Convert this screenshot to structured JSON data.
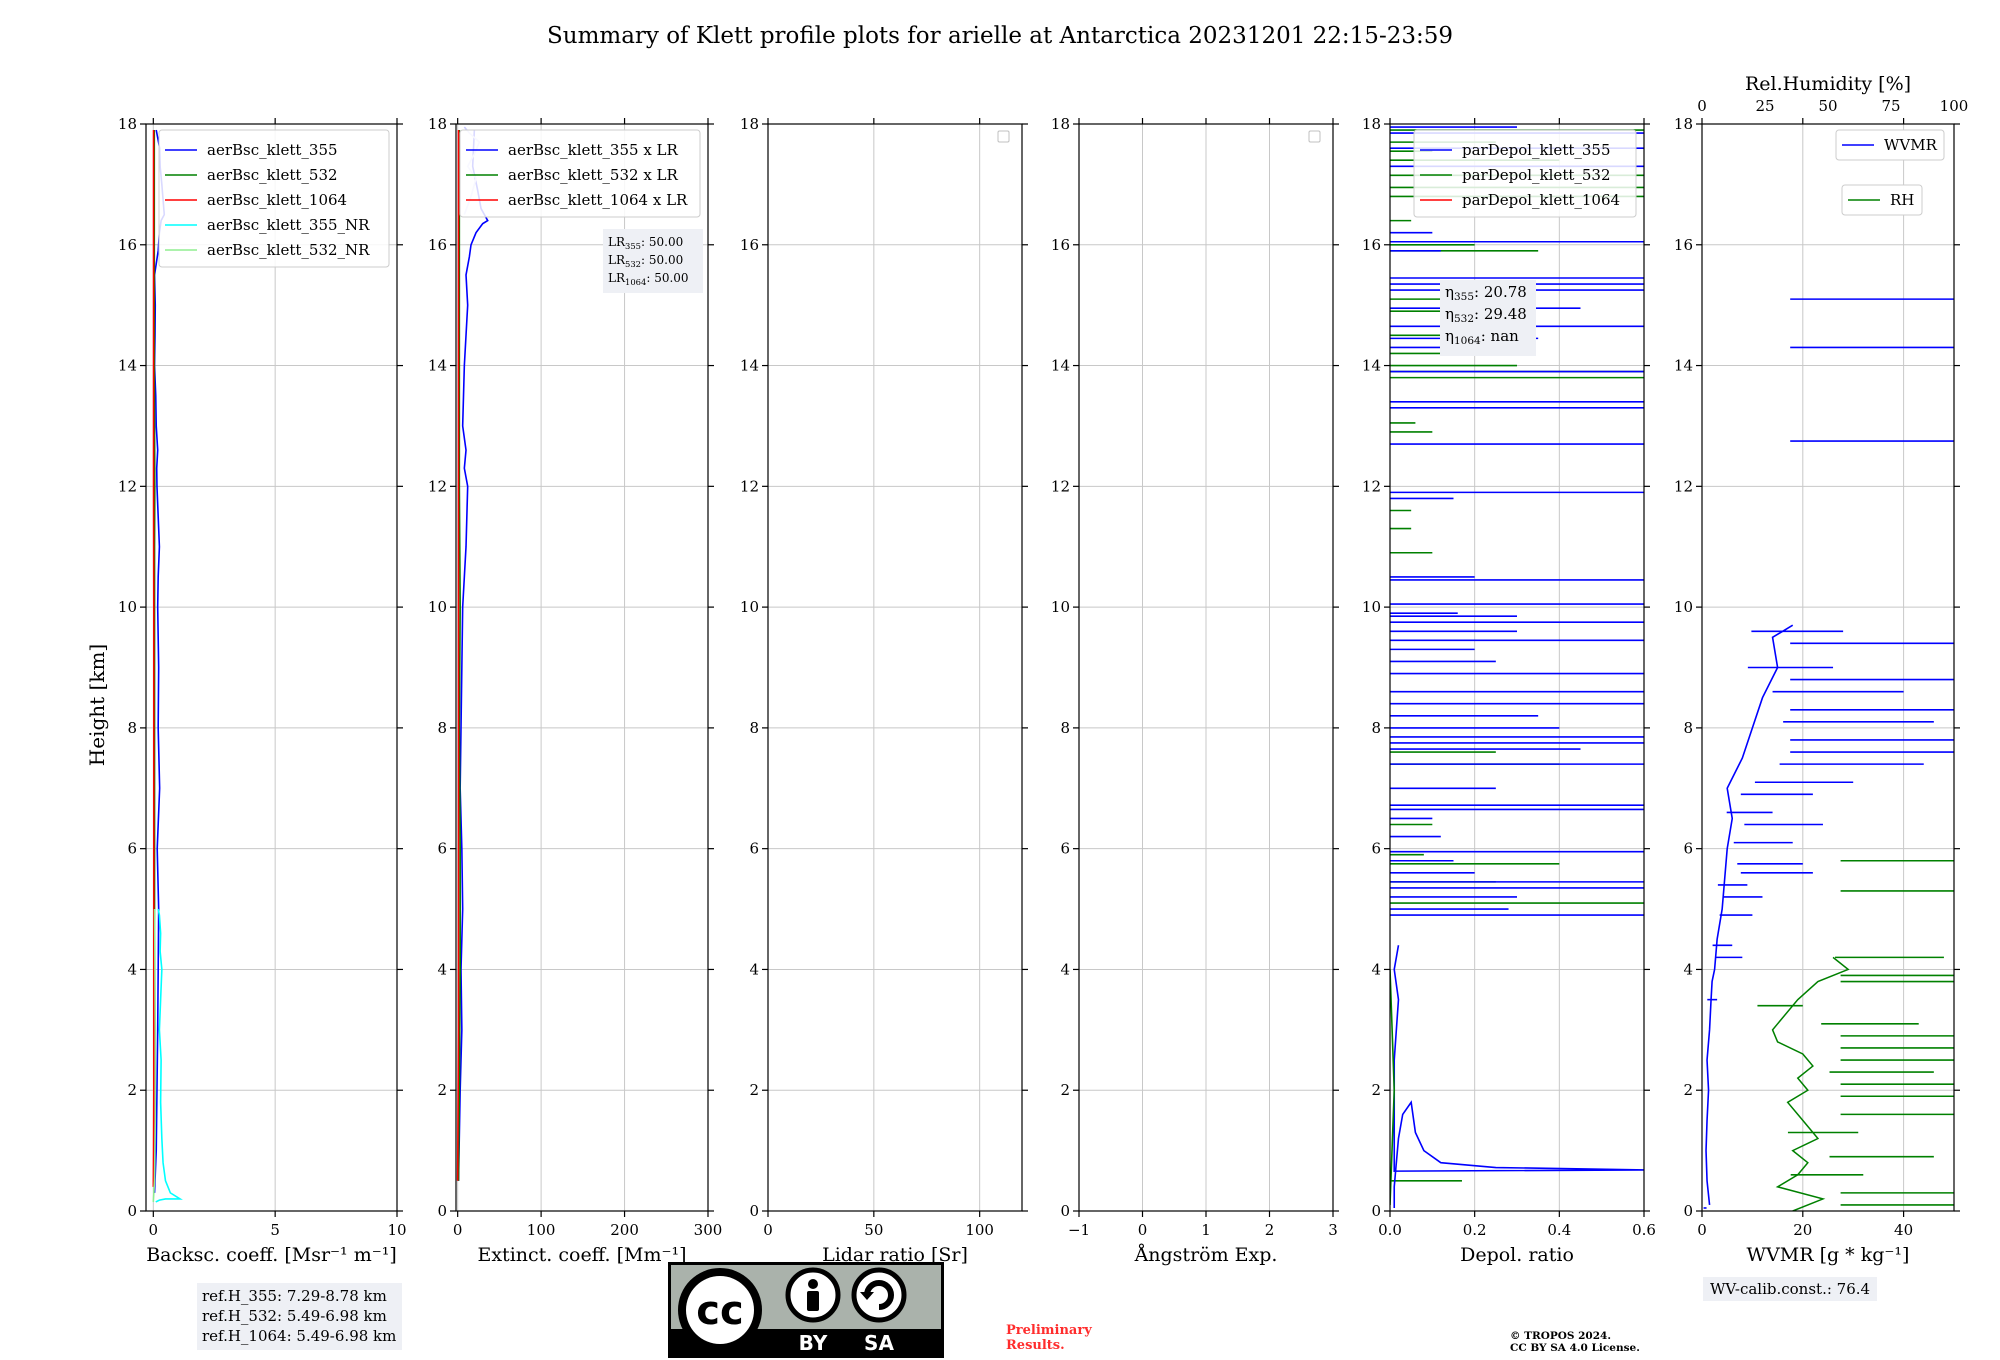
{
  "title": "Summary of Klett profile plots for arielle at Antarctica 20231201 22:15-23:59",
  "y_label": "Height [km]",
  "chart_data": [
    {
      "type": "line",
      "xlabel": "Backsc. coeff. [Msr⁻¹ m⁻¹]",
      "xlim": [
        -0.3,
        10
      ],
      "ylim": [
        0,
        18
      ],
      "xticks": [
        "0",
        "5",
        "10"
      ],
      "xtick_values": [
        0,
        5,
        10
      ],
      "legend_position": "top-right",
      "grid": true,
      "series": [
        {
          "name": "aerBsc_klett_355",
          "color": "#0000ff",
          "x": [
            0.05,
            0.12,
            0.15,
            0.18,
            0.2,
            0.22,
            0.16,
            0.26,
            0.2,
            0.22,
            0.18,
            0.2,
            0.25,
            0.2,
            0.15,
            0.14,
            0.18,
            0.12,
            0.1,
            0.05,
            0.07,
            0.08,
            0.05,
            0.2,
            0.25,
            0.32,
            0.45,
            0.35,
            0.28,
            0.26,
            0.12
          ],
          "y": [
            0.3,
            1.0,
            2.0,
            3.0,
            4.0,
            5.0,
            6.0,
            7.0,
            8.0,
            9.0,
            10.0,
            10.5,
            11.0,
            11.5,
            12.0,
            12.3,
            12.6,
            13.0,
            13.5,
            14.0,
            14.5,
            15.0,
            15.5,
            15.9,
            16.2,
            16.4,
            16.5,
            17.0,
            17.3,
            17.6,
            17.9
          ]
        },
        {
          "name": "aerBsc_klett_532",
          "color": "#008000",
          "x": [
            0.02,
            0.04,
            0.06,
            0.05,
            0.04,
            0.05,
            0.05,
            0.05,
            0.05,
            0.05,
            0.05,
            0.05,
            0.06,
            0.05,
            0.04,
            0.04,
            0.04,
            0.04,
            0.04
          ],
          "y": [
            0.5,
            1.0,
            2.0,
            3.0,
            4.0,
            5.0,
            6.0,
            7.0,
            8.0,
            9.0,
            10.0,
            11.0,
            12.0,
            13.0,
            14.0,
            15.0,
            16.0,
            17.0,
            17.9
          ]
        },
        {
          "name": "aerBsc_klett_1064",
          "color": "#ff0000",
          "x": [
            0.0,
            0.01,
            0.02,
            0.02,
            0.02,
            0.02,
            0.02,
            0.01,
            0.01,
            0.01,
            0.01
          ],
          "y": [
            0.4,
            1.0,
            2.0,
            4.0,
            6.0,
            8.0,
            10.0,
            12.0,
            14.0,
            16.0,
            17.9
          ]
        },
        {
          "name": "aerBsc_klett_355_NR",
          "color": "#00ffff",
          "x": [
            0.1,
            0.25,
            0.5,
            1.1,
            0.7,
            0.5,
            0.4,
            0.35,
            0.3,
            0.32,
            0.25,
            0.3,
            0.35,
            0.28,
            0.3,
            0.25,
            0.2
          ],
          "y": [
            0.15,
            0.18,
            0.2,
            0.2,
            0.3,
            0.5,
            0.8,
            1.2,
            1.8,
            2.5,
            3.0,
            3.5,
            4.0,
            4.3,
            4.6,
            4.9,
            5.0
          ]
        },
        {
          "name": "aerBsc_klett_532_NR",
          "color": "#90ee90",
          "x": [
            0.0,
            0.05,
            0.08,
            0.08,
            0.06,
            0.05
          ],
          "y": [
            0.15,
            0.5,
            1.5,
            3.0,
            4.5,
            5.0
          ]
        }
      ]
    },
    {
      "type": "line",
      "xlabel": "Extinct. coeff. [Mm⁻¹]",
      "xlim": [
        -2,
        300
      ],
      "ylim": [
        0,
        18
      ],
      "xticks": [
        "0",
        "100",
        "200",
        "300"
      ],
      "xtick_values": [
        0,
        100,
        200,
        300
      ],
      "legend_position": "top-right",
      "grid": true,
      "series": [
        {
          "name": "aerBsc_klett_355 x LR",
          "color": "#0000ff",
          "x": [
            1,
            3,
            5,
            4,
            6,
            5,
            3,
            4,
            5,
            6,
            8,
            10,
            12,
            8,
            10,
            6,
            8,
            10,
            12,
            10,
            14,
            16,
            22,
            30,
            36,
            28,
            24,
            18,
            20
          ],
          "y": [
            0.5,
            2.0,
            3.0,
            4.0,
            5.0,
            6.0,
            7.0,
            8.0,
            9.0,
            10.0,
            10.5,
            11.0,
            12.0,
            12.3,
            12.6,
            13.0,
            14.0,
            14.5,
            15.0,
            15.5,
            15.8,
            16.0,
            16.2,
            16.35,
            16.4,
            16.6,
            16.9,
            17.3,
            17.9
          ]
        },
        {
          "name": "aerBsc_klett_532 x LR",
          "color": "#008000",
          "x": [
            1,
            2,
            3,
            3,
            2,
            3,
            2,
            2,
            2,
            2
          ],
          "y": [
            0.5,
            2.0,
            4.0,
            6.0,
            8.0,
            10.0,
            12.0,
            14.0,
            16.0,
            17.9
          ]
        },
        {
          "name": "aerBsc_klett_1064 x LR",
          "color": "#ff0000",
          "x": [
            0,
            1,
            1,
            1,
            1,
            1
          ],
          "y": [
            0.5,
            3.0,
            6.0,
            10.0,
            14.0,
            17.9
          ]
        },
        {
          "name": "",
          "color": "#ccccff",
          "x": [
            8,
            16,
            22,
            12,
            20,
            26,
            14,
            8
          ],
          "y": [
            16.5,
            16.8,
            17.1,
            17.3,
            17.5,
            17.7,
            17.85,
            17.95
          ]
        }
      ],
      "annotation": [
        {
          "label": "LR",
          "sub": "355",
          "value": ": 50.00"
        },
        {
          "label": "LR",
          "sub": "532",
          "value": ": 50.00"
        },
        {
          "label": "LR",
          "sub": "1064",
          "value": ": 50.00"
        }
      ]
    },
    {
      "type": "line",
      "xlabel": "Lidar ratio [Sr]",
      "xlim": [
        0,
        120
      ],
      "ylim": [
        0,
        18
      ],
      "xticks": [
        "0",
        "50",
        "100"
      ],
      "xtick_values": [
        0,
        50,
        100
      ],
      "legend_position": "top-right",
      "grid": true,
      "series": []
    },
    {
      "type": "line",
      "xlabel": "Ångström Exp.",
      "xlim": [
        -1,
        3
      ],
      "ylim": [
        0,
        18
      ],
      "xticks": [
        "−1",
        "0",
        "1",
        "2",
        "3"
      ],
      "xtick_values": [
        -1,
        0,
        1,
        2,
        3
      ],
      "legend_position": "top-right",
      "grid": true,
      "series": []
    },
    {
      "type": "line",
      "xlabel": "Depol. ratio",
      "xlim": [
        0,
        0.6
      ],
      "ylim": [
        0,
        18
      ],
      "xticks": [
        "0.0",
        "0.2",
        "0.4",
        "0.6"
      ],
      "xtick_values": [
        0.0,
        0.2,
        0.4,
        0.6
      ],
      "legend_position": "top-right",
      "grid": true,
      "series": [
        {
          "name": "parDepol_klett_355",
          "color": "#0000ff",
          "x": [
            0.01,
            0.01,
            0.02,
            0.03,
            0.05,
            0.06,
            0.08,
            0.12,
            0.25,
            0.6,
            0.01,
            0.01,
            0.02,
            0.01,
            0.02
          ],
          "y": [
            0.05,
            0.4,
            1.2,
            1.6,
            1.8,
            1.3,
            1.0,
            0.8,
            0.72,
            0.68,
            0.66,
            2.5,
            3.5,
            4.0,
            4.4
          ]
        },
        {
          "name": "parDepol_klett_532",
          "color": "#008000",
          "x": [
            0.0,
            0.01,
            0.0
          ],
          "y": [
            0.1,
            2.0,
            4.0
          ]
        },
        {
          "name": "parDepol_klett_1064",
          "color": "#ff0000",
          "x": [],
          "y": []
        }
      ],
      "spikes_355": [
        [
          4.9,
          0.6
        ],
        [
          5.0,
          0.28
        ],
        [
          5.2,
          0.3
        ],
        [
          5.35,
          0.6
        ],
        [
          5.45,
          0.6
        ],
        [
          5.6,
          0.2
        ],
        [
          5.8,
          0.15
        ],
        [
          5.95,
          0.6
        ],
        [
          6.2,
          0.12
        ],
        [
          6.5,
          0.1
        ],
        [
          6.65,
          0.6
        ],
        [
          6.72,
          0.6
        ],
        [
          7.0,
          0.25
        ],
        [
          7.4,
          0.6
        ],
        [
          7.65,
          0.45
        ],
        [
          7.75,
          0.6
        ],
        [
          7.85,
          0.6
        ],
        [
          8.0,
          0.4
        ],
        [
          8.2,
          0.35
        ],
        [
          8.4,
          0.6
        ],
        [
          8.6,
          0.6
        ],
        [
          8.9,
          0.6
        ],
        [
          9.1,
          0.25
        ],
        [
          9.3,
          0.2
        ],
        [
          9.45,
          0.6
        ],
        [
          9.6,
          0.3
        ],
        [
          9.75,
          0.6
        ],
        [
          9.85,
          0.3
        ],
        [
          9.9,
          0.16
        ],
        [
          10.05,
          0.6
        ],
        [
          10.45,
          0.6
        ],
        [
          10.5,
          0.2
        ],
        [
          11.8,
          0.15
        ],
        [
          11.9,
          0.6
        ],
        [
          12.7,
          0.6
        ],
        [
          13.3,
          0.6
        ],
        [
          13.4,
          0.6
        ],
        [
          13.9,
          0.6
        ],
        [
          14.3,
          0.2
        ],
        [
          14.45,
          0.35
        ],
        [
          14.65,
          0.6
        ],
        [
          14.95,
          0.45
        ],
        [
          15.25,
          0.6
        ],
        [
          15.35,
          0.6
        ],
        [
          15.45,
          0.6
        ],
        [
          15.9,
          0.12
        ],
        [
          16.05,
          0.6
        ],
        [
          16.2,
          0.1
        ],
        [
          17.3,
          0.6
        ],
        [
          17.6,
          0.6
        ],
        [
          17.85,
          0.6
        ],
        [
          17.95,
          0.3
        ]
      ],
      "spikes_532": [
        [
          0.5,
          0.17
        ],
        [
          5.1,
          0.6
        ],
        [
          5.45,
          0.25
        ],
        [
          5.75,
          0.4
        ],
        [
          5.9,
          0.08
        ],
        [
          6.4,
          0.1
        ],
        [
          7.4,
          0.4
        ],
        [
          7.6,
          0.25
        ],
        [
          10.9,
          0.1
        ],
        [
          11.3,
          0.05
        ],
        [
          11.6,
          0.05
        ],
        [
          12.9,
          0.1
        ],
        [
          13.05,
          0.06
        ],
        [
          13.8,
          0.6
        ],
        [
          13.9,
          0.6
        ],
        [
          14.0,
          0.3
        ],
        [
          14.2,
          0.2
        ],
        [
          14.5,
          0.12
        ],
        [
          14.9,
          0.3
        ],
        [
          15.1,
          0.25
        ],
        [
          15.9,
          0.35
        ],
        [
          16.0,
          0.2
        ],
        [
          16.4,
          0.05
        ],
        [
          16.8,
          0.6
        ],
        [
          16.95,
          0.6
        ],
        [
          17.15,
          0.6
        ],
        [
          17.4,
          0.4
        ],
        [
          17.55,
          0.1
        ],
        [
          17.7,
          0.25
        ],
        [
          17.9,
          0.6
        ]
      ],
      "annotation": [
        {
          "label": "η",
          "sub": "355",
          "value": ": 20.78"
        },
        {
          "label": "η",
          "sub": "532",
          "value": ": 29.48"
        },
        {
          "label": "η",
          "sub": "1064",
          "value": ": nan"
        }
      ]
    },
    {
      "type": "line",
      "xlabel": "WVMR [g * kg⁻¹]",
      "x2label": "Rel.Humidity [%]",
      "xlim": [
        0,
        50
      ],
      "ylim": [
        0,
        18
      ],
      "xticks": [
        "0",
        "20",
        "40"
      ],
      "xtick_values": [
        0,
        20,
        40
      ],
      "x2lim": [
        0,
        100
      ],
      "x2ticks": [
        "0",
        "25",
        "50",
        "75",
        "100"
      ],
      "x2tick_values": [
        0,
        25,
        50,
        75,
        100
      ],
      "legend_position": "top-right",
      "grid": true,
      "series": [
        {
          "name": "WVMR",
          "color": "#0000ff",
          "x": [
            1.5,
            1.0,
            0.8,
            1.0,
            1.3,
            1.0,
            1.5,
            1.8,
            2.0,
            2.5,
            3.0,
            4.0,
            4.5,
            5.0,
            6.0,
            5.0,
            8.0,
            10.0,
            12.0,
            15.0,
            14.0,
            16.0,
            18.0
          ],
          "y": [
            0.1,
            0.5,
            1.0,
            1.5,
            2.0,
            2.5,
            3.0,
            3.5,
            3.8,
            4.0,
            4.5,
            5.0,
            5.5,
            6.0,
            6.5,
            7.0,
            7.5,
            8.0,
            8.5,
            9.0,
            9.5,
            9.6,
            9.7
          ]
        },
        {
          "name": "RH",
          "color": "#008000",
          "x": [],
          "y": []
        }
      ],
      "spikes_wvmr": [
        [
          0.05,
          0.9
        ],
        [
          3.5,
          3
        ],
        [
          4.2,
          8
        ],
        [
          4.4,
          6
        ],
        [
          4.9,
          10
        ],
        [
          5.2,
          12
        ],
        [
          5.4,
          9
        ],
        [
          5.6,
          22
        ],
        [
          5.75,
          20
        ],
        [
          6.1,
          18
        ],
        [
          6.4,
          24
        ],
        [
          6.6,
          14
        ],
        [
          6.9,
          22
        ],
        [
          7.1,
          30
        ],
        [
          7.4,
          44
        ],
        [
          7.6,
          50
        ],
        [
          7.8,
          50
        ],
        [
          8.1,
          46
        ],
        [
          8.3,
          50
        ],
        [
          8.6,
          40
        ],
        [
          8.8,
          50
        ],
        [
          9.0,
          26
        ],
        [
          9.4,
          50
        ],
        [
          9.6,
          28
        ],
        [
          12.75,
          50
        ],
        [
          14.3,
          50
        ],
        [
          15.1,
          50
        ]
      ],
      "spikes_rh_pct": [
        [
          0.1,
          100
        ],
        [
          0.3,
          100
        ],
        [
          0.6,
          64
        ],
        [
          0.9,
          92
        ],
        [
          1.3,
          62
        ],
        [
          1.6,
          100
        ],
        [
          1.9,
          100
        ],
        [
          2.1,
          100
        ],
        [
          2.3,
          92
        ],
        [
          2.5,
          100
        ],
        [
          2.7,
          100
        ],
        [
          2.9,
          100
        ],
        [
          3.1,
          86
        ],
        [
          3.4,
          40
        ],
        [
          3.8,
          100
        ],
        [
          3.9,
          100
        ],
        [
          4.2,
          96
        ],
        [
          5.3,
          100
        ],
        [
          5.8,
          100
        ]
      ],
      "rh_profile": {
        "x_pct": [
          36,
          48,
          30,
          38,
          42,
          36,
          46,
          40,
          34,
          42,
          38,
          44,
          40,
          30,
          28,
          32,
          38,
          46,
          58,
          52
        ],
        "y": [
          0.0,
          0.2,
          0.4,
          0.6,
          0.8,
          1.0,
          1.2,
          1.5,
          1.8,
          2.0,
          2.2,
          2.4,
          2.6,
          2.8,
          3.0,
          3.2,
          3.5,
          3.8,
          4.0,
          4.2
        ]
      }
    }
  ],
  "ref_heights": [
    "ref.H_355: 7.29-8.78 km",
    "ref.H_532: 5.49-6.98 km",
    "ref.H_1064: 5.49-6.98 km"
  ],
  "wv_calib": "WV-calib.const.: 76.4",
  "preliminary": [
    "Preliminary",
    "Results."
  ],
  "copyright": [
    "© TROPOS 2024.",
    "CC BY SA 4.0 License."
  ],
  "license_badge": {
    "text_cc": "cc",
    "text_by": "BY",
    "text_sa": "SA"
  }
}
